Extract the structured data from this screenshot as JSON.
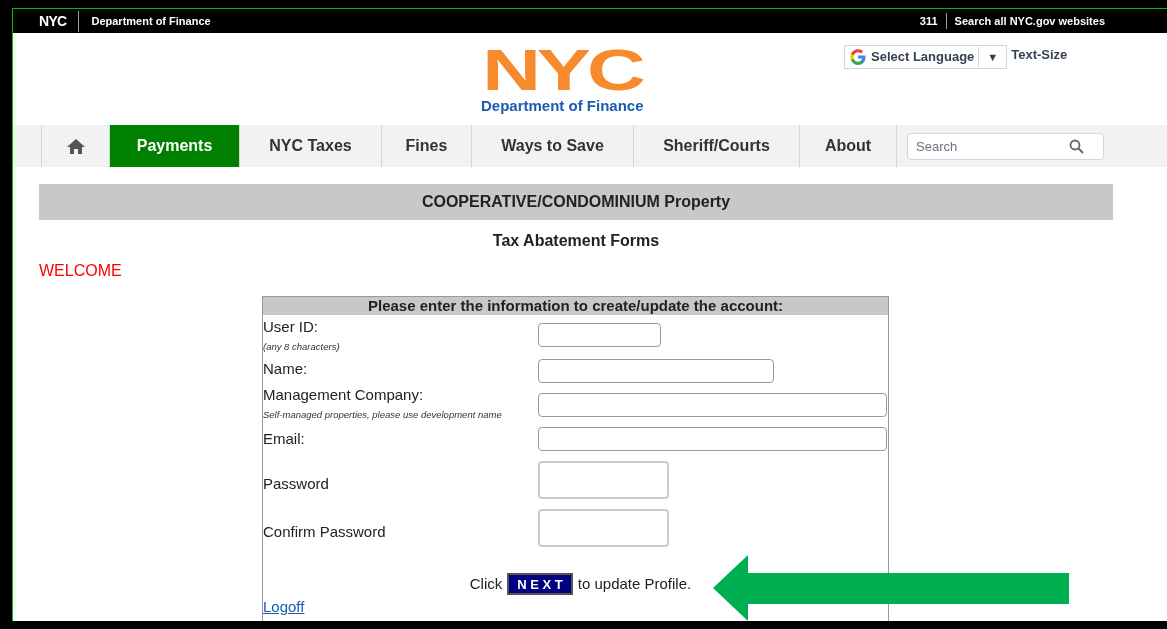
{
  "top_bar": {
    "logo": "NYC",
    "agency": "Department of Finance",
    "phone": "311",
    "search_link": "Search all NYC.gov websites"
  },
  "header": {
    "logo": "NYC",
    "agency": "Department of Finance",
    "language": "Select Language",
    "language_caret": "▼",
    "text_size": "Text-Size"
  },
  "nav": {
    "items": [
      {
        "label": "Payments",
        "selected": true
      },
      {
        "label": "NYC Taxes",
        "selected": false
      },
      {
        "label": "Fines",
        "selected": false
      },
      {
        "label": "Ways to Save",
        "selected": false
      },
      {
        "label": "Sheriff/Courts",
        "selected": false
      },
      {
        "label": "About",
        "selected": false
      }
    ],
    "search": {
      "placeholder": "Search"
    }
  },
  "page_title": "COOPERATIVE/CONDOMINIUM Property",
  "subtitle": "Tax Abatement Forms",
  "welcome": "WELCOME",
  "form": {
    "heading": "Please enter the information to create/update the account:",
    "fields": [
      {
        "label": "User ID:",
        "hint": "(any 8 characters)",
        "kind": "text"
      },
      {
        "label": "Name:",
        "kind": "text"
      },
      {
        "label": "Management Company:",
        "hint": "Self-managed properties, please use development name",
        "kind": "text"
      },
      {
        "label": "Email:",
        "kind": "text"
      },
      {
        "label": "Password",
        "kind": "password"
      },
      {
        "label": "Confirm Password",
        "kind": "password"
      }
    ],
    "prompt_before": "Click",
    "button": "N E X T",
    "prompt_after": "to update Profile.",
    "logoff": "Logoff"
  }
}
